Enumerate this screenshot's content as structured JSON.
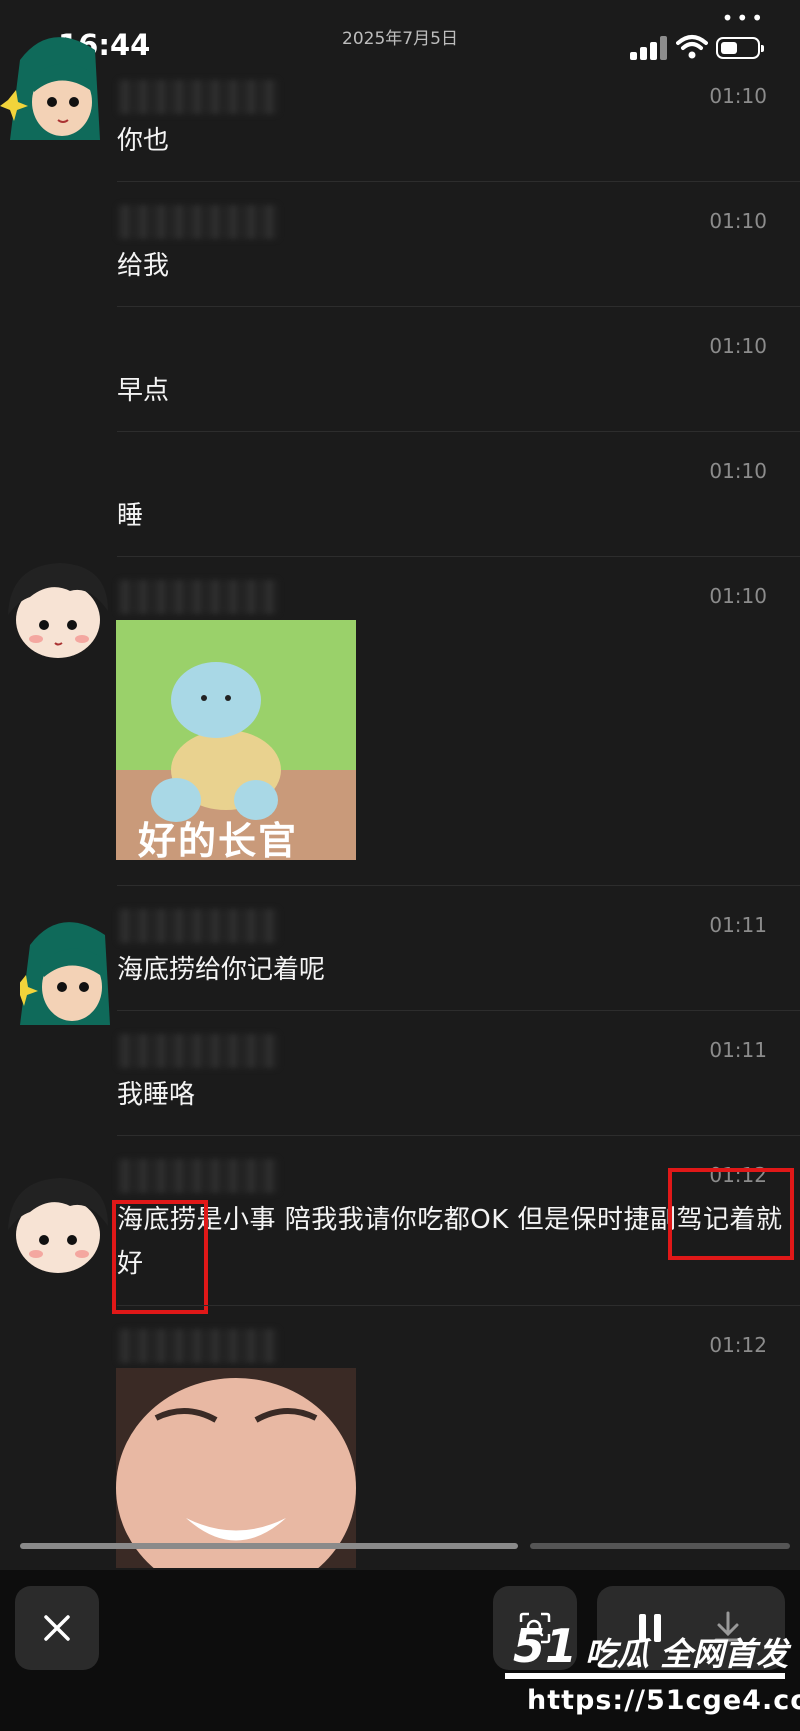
{
  "status_bar": {
    "time": "16:44",
    "date": "2025年7月5日",
    "more_icon": "ellipsis-icon",
    "signal_icon": "signal-icon",
    "wifi_icon": "wifi-icon",
    "battery_icon": "battery-icon"
  },
  "messages": [
    {
      "time": "01:10",
      "text": "你也"
    },
    {
      "time": "01:10",
      "text": "给我"
    },
    {
      "time": "01:10",
      "text": "早点"
    },
    {
      "time": "01:10",
      "text": "睡"
    },
    {
      "time": "01:10",
      "sticker_caption": "好的长官"
    },
    {
      "time": "01:11",
      "text": "海底捞给你记着呢"
    },
    {
      "time": "01:11",
      "text": "我睡咯"
    },
    {
      "time": "01:12",
      "text": "海底捞是小事  陪我我请你吃都OK  但是保时捷副驾记着就好"
    },
    {
      "time": "01:12",
      "image": "photo"
    }
  ],
  "bottom_bar": {
    "close_icon": "close-icon",
    "scan_icon": "scan-icon",
    "pause_icon": "pause-icon",
    "download_icon": "download-icon"
  },
  "watermark": {
    "number": "51",
    "line1": "吃瓜 全网首发",
    "line2": "https://51cge4.com"
  },
  "colors": {
    "background": "#1b1b1b",
    "highlight": "#e01818",
    "time_text": "#8c8c8c"
  }
}
